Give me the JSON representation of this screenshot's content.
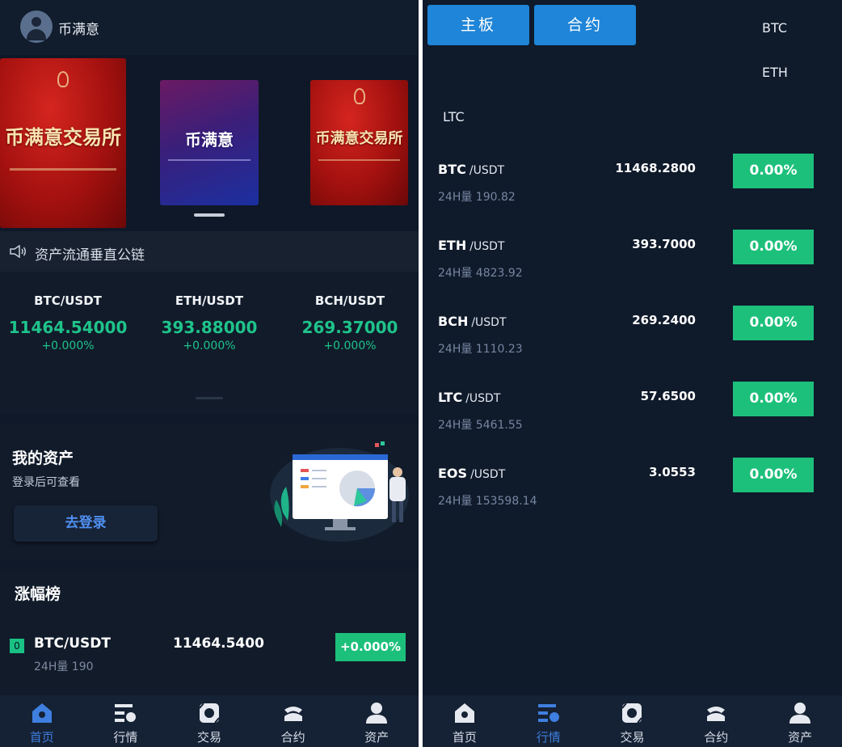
{
  "left": {
    "header": {
      "username": "币满意"
    },
    "carousel": {
      "banners": [
        {
          "text": "币满意交易所"
        },
        {
          "text": "币满意"
        },
        {
          "text": "币满意交易所"
        }
      ]
    },
    "notice": {
      "text": "资产流通垂直公链"
    },
    "tickers": [
      {
        "pair": "BTC/USDT",
        "price": "11464.54000",
        "change": "+0.000%"
      },
      {
        "pair": "ETH/USDT",
        "price": "393.88000",
        "change": "+0.000%"
      },
      {
        "pair": "BCH/USDT",
        "price": "269.37000",
        "change": "+0.000%"
      }
    ],
    "assets": {
      "title": "我的资产",
      "hint": "登录后可查看",
      "login_label": "去登录"
    },
    "gainers": {
      "title": "涨幅榜",
      "rows": [
        {
          "rank": "0",
          "pair": "BTC/USDT",
          "volume": "24H量 190",
          "price": "11464.5400",
          "change": "+0.000%"
        }
      ]
    },
    "tabbar": [
      {
        "label": "首页",
        "icon": "home-icon",
        "active": true
      },
      {
        "label": "行情",
        "icon": "market-icon",
        "active": false
      },
      {
        "label": "交易",
        "icon": "trade-icon",
        "active": false
      },
      {
        "label": "合约",
        "icon": "contract-icon",
        "active": false
      },
      {
        "label": "资产",
        "icon": "user-icon",
        "active": false
      }
    ]
  },
  "right": {
    "segments": [
      {
        "label": "主板"
      },
      {
        "label": "合约"
      }
    ],
    "symbol_tabs": [
      "BTC",
      "ETH",
      "LTC"
    ],
    "market_rows": [
      {
        "coin": "BTC",
        "quote": "/USDT",
        "volume": "24H量  190.82",
        "price": "11468.2800",
        "change": "0.00%"
      },
      {
        "coin": "ETH",
        "quote": "/USDT",
        "volume": "24H量  4823.92",
        "price": "393.7000",
        "change": "0.00%"
      },
      {
        "coin": "BCH",
        "quote": "/USDT",
        "volume": "24H量  1110.23",
        "price": "269.2400",
        "change": "0.00%"
      },
      {
        "coin": "LTC",
        "quote": "/USDT",
        "volume": "24H量  5461.55",
        "price": "57.6500",
        "change": "0.00%"
      },
      {
        "coin": "EOS",
        "quote": "/USDT",
        "volume": "24H量  153598.14",
        "price": "3.0553",
        "change": "0.00%"
      }
    ],
    "tabbar": [
      {
        "label": "首页",
        "icon": "home-icon",
        "active": false
      },
      {
        "label": "行情",
        "icon": "market-icon",
        "active": true
      },
      {
        "label": "交易",
        "icon": "trade-icon",
        "active": false
      },
      {
        "label": "合约",
        "icon": "contract-icon",
        "active": false
      },
      {
        "label": "资产",
        "icon": "user-icon",
        "active": false
      }
    ]
  },
  "colors": {
    "accent_green": "#1dc07b",
    "accent_blue": "#1f85d8",
    "active_tab": "#3f7fe0",
    "background": "#10192a"
  }
}
